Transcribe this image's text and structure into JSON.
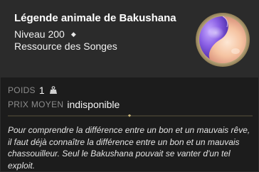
{
  "item": {
    "title": "Légende animale de Bakushana",
    "level": "Niveau 200",
    "type": "Ressource des Songes",
    "icon": "dream-orb-icon"
  },
  "stats": {
    "weight_label": "POIDS",
    "weight_value": "1",
    "price_label": "PRIX MOYEN",
    "price_value": "indisponible"
  },
  "description": "Pour comprendre la différence entre un bon et un mauvais rêve, il faut déjà connaître la différence entre un bon et un mauvais chassouilleur. Seul le Bakushana pouvait se vanter d'un tel exploit.",
  "colors": {
    "header_bg": "#2b2b2b",
    "body_bg": "#1c1c1c",
    "divider_gold": "#b8a46a",
    "orb_purple": "#7e56d8",
    "orb_peach": "#f3c9a8"
  }
}
